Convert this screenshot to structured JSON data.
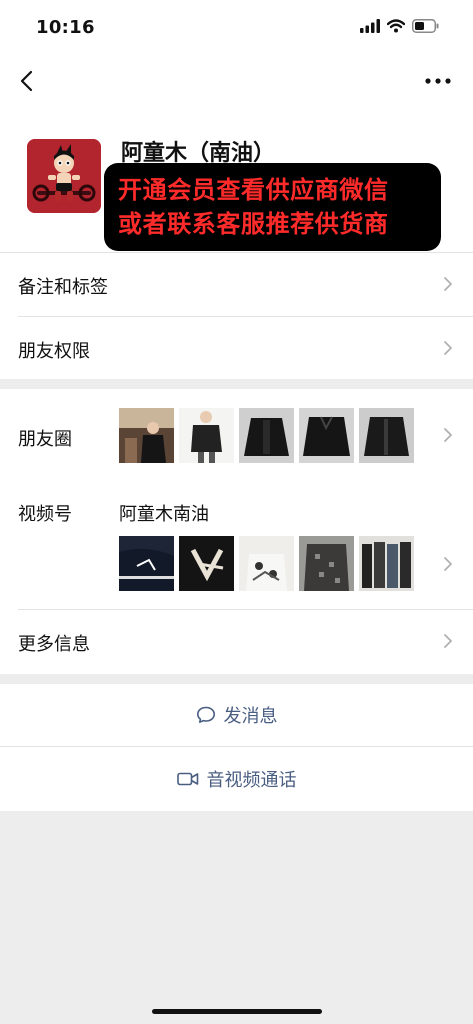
{
  "status_bar": {
    "time": "10:16",
    "icons": [
      "signal-icon",
      "wifi-icon",
      "battery-icon"
    ]
  },
  "nav": {
    "back_icon": "chevron-left-icon",
    "more_icon": "ellipsis-icon"
  },
  "profile": {
    "name": "阿童木（南油）",
    "banner_lines": [
      "开通会员查看供应商微信",
      "或者联系客服推荐供货商"
    ]
  },
  "settings": {
    "remarks_tags": "备注和标签",
    "friend_permissions": "朋友权限"
  },
  "moments": {
    "label": "朋友圈",
    "thumbnail_count": 5
  },
  "channels": {
    "label": "视频号",
    "channel_name": "阿童木南油",
    "thumbnail_count": 5
  },
  "more_info": {
    "label": "更多信息"
  },
  "actions": {
    "message": "发消息",
    "call": "音视频通话"
  },
  "colors": {
    "banner_text": "#ff2b2b",
    "action_text": "#4a5e82",
    "page_bg": "#ededed"
  }
}
